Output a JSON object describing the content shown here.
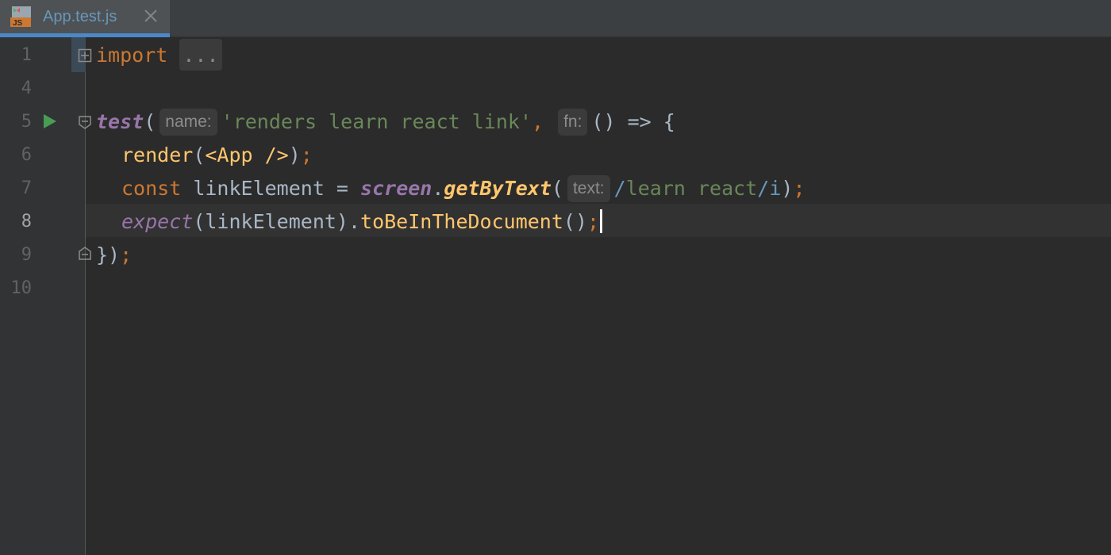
{
  "tab": {
    "label": "App.test.js",
    "file_icon_text": "JS",
    "close_icon": "close-icon"
  },
  "editor": {
    "line_numbers": [
      "1",
      "4",
      "5",
      "6",
      "7",
      "8",
      "9",
      "10"
    ],
    "current_line": "8",
    "code": {
      "line1": {
        "keyword": "import",
        "folded": "..."
      },
      "line5": {
        "fn": "test",
        "open": "(",
        "hint_name": "name:",
        "string": "'renders learn react link'",
        "comma": ",",
        "hint_fn": "fn:",
        "arrow": "() => {"
      },
      "line6": {
        "call": "render",
        "open": "(",
        "jsx": "<App />",
        "close": ")",
        "semi": ";"
      },
      "line7": {
        "keyword": "const",
        "decl": " linkElement = ",
        "obj": "screen",
        "dot": ".",
        "method": "getByText",
        "open": "(",
        "hint_text": "text:",
        "regex_slash1": "/",
        "regex_body": "learn react",
        "regex_slash2": "/",
        "regex_flag": "i",
        "close": ")",
        "semi": ";"
      },
      "line8": {
        "fn": "expect",
        "args": "(linkElement).",
        "method": "toBeInTheDocument",
        "parens": "()",
        "semi": ";"
      },
      "line9": {
        "close": "})",
        "semi": ";"
      }
    }
  },
  "colors": {
    "background": "#2b2b2b",
    "keyword": "#cc7832",
    "function": "#ffc66d",
    "string": "#6a8759",
    "italic_purple": "#9876aa",
    "accent": "#4a88c7"
  }
}
